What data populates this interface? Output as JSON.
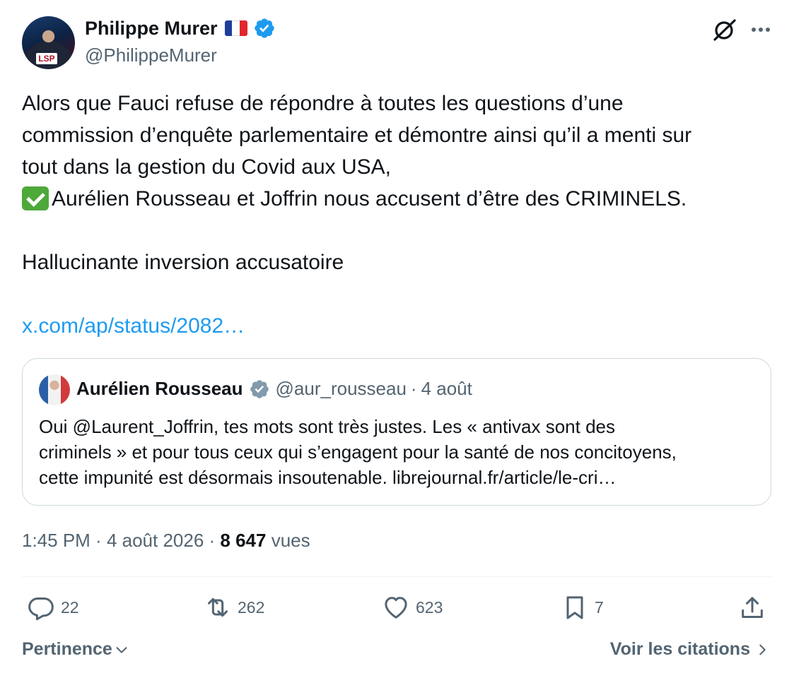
{
  "tweet": {
    "author": {
      "name": "Philippe Murer",
      "handle": "@PhilippeMurer",
      "avatar_badge": "LSP",
      "flag_colors": [
        "#1f3e9c",
        "#ffffff",
        "#e1262d"
      ]
    },
    "body": {
      "line1": "Alors que Fauci refuse de répondre à toutes les questions d’une",
      "line2": "commission d’enquête parlementaire et démontre ainsi qu’il a menti sur",
      "line3": "tout dans la gestion du Covid aux USA,",
      "line4": "Aurélien Rousseau et Joffrin nous accusent d’être des CRIMINELS.",
      "line5": "Hallucinante inversion accusatoire",
      "link": "x.com/ap/status/2082…"
    },
    "quote": {
      "name": "Aurélien Rousseau",
      "handle": "@aur_rousseau",
      "separator": "·",
      "date": "4 août",
      "line1": "Oui @Laurent_Joffrin, tes mots sont très justes. Les « antivax sont des",
      "line2": "criminels » et pour tous ceux qui s’engagent pour la santé de nos concitoyens,",
      "line3": "cette impunité est désormais insoutenable. librejournal.fr/article/le-cri…"
    },
    "timestamp": {
      "time": "1:45 PM",
      "sep1": " · ",
      "date": "4 août 2026",
      "sep2": " · ",
      "views_count": "8 647",
      "views_label": " vues"
    },
    "actions": {
      "replies": "22",
      "reposts": "262",
      "likes": "623",
      "bookmarks": "7"
    },
    "footer": {
      "sort_label": "Pertinence",
      "quotes_label": "Voir les citations"
    },
    "colors": {
      "verified_blue": "#1d9bf0",
      "verified_gray": "#829aab",
      "link": "#1d9bf0",
      "muted": "#536471"
    }
  }
}
